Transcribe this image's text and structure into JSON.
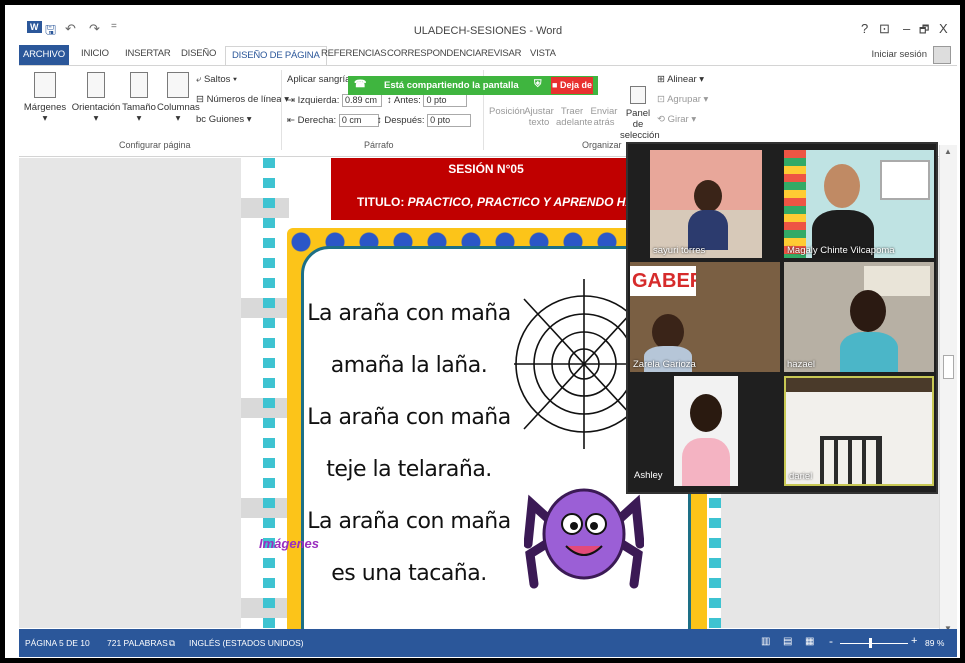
{
  "window": {
    "title": "ULADECH-SESIONES - Word",
    "help": "?",
    "controls": {
      "ribbon_opts": "⊡",
      "minimize": "–",
      "restore": "🗗",
      "close": "X"
    },
    "sign_in": "Iniciar sesión"
  },
  "quick_access": {
    "word_icon": "W",
    "save": "🖫",
    "undo": "↶",
    "redo": "↷",
    "customize": "="
  },
  "tabs": [
    "ARCHIVO",
    "INICIO",
    "INSERTAR",
    "DISEÑO",
    "DISEÑO DE PÁGINA",
    "REFERENCIAS",
    "CORRESPONDENCIA",
    "REVISAR",
    "VISTA"
  ],
  "ribbon": {
    "margenes": "Márgenes",
    "orientacion": "Orientación",
    "tamano": "Tamaño",
    "columnas": "Columnas",
    "saltos": "Saltos",
    "numeros_linea": "Números de línea",
    "guiones": "Guiones",
    "group_configurar": "Configurar página",
    "aplicar_sangria": "Aplicar sangría",
    "izquierda_label": "Izquierda:",
    "izquierda_value": "0.89 cm",
    "derecha_label": "Derecha:",
    "derecha_value": "0 cm",
    "antes_label": "Antes:",
    "antes_value": "0 pto",
    "despues_label": "Después:",
    "despues_value": "0 pto",
    "group_parrafo": "Párrafo",
    "posicion": "Posición",
    "ajustar_texto": "Ajustar texto",
    "traer_adelante": "Traer adelante",
    "enviar_atras": "Enviar atrás",
    "panel_seleccion": "Panel de selección",
    "alinear": "Alinear",
    "agrupar": "Agrupar",
    "girar": "Girar",
    "group_organizar": "Organizar"
  },
  "share_banner": {
    "text": "Está compartiendo la pantalla",
    "stop": "■ Deja de"
  },
  "document": {
    "session": "SESIÓN N°05",
    "title_prefix": "TITULO:",
    "title_text": "PRACTICO, PRACTICO Y APRENDO HABLA",
    "poem": [
      "La araña con maña",
      "amaña la laña.",
      "La araña con maña",
      "teje  la telaraña.",
      "La araña con maña",
      "es una tacaña."
    ],
    "footer_word": "Imágenes"
  },
  "participants": [
    {
      "name": "sayuri torres"
    },
    {
      "name": "Magaly Chinte Vilcapoma"
    },
    {
      "name": "Zarela Garioza",
      "sign_text": "GABER"
    },
    {
      "name": "hazael"
    },
    {
      "name": "Ashley"
    },
    {
      "name": "dariel"
    }
  ],
  "status": {
    "page": "PÁGINA 5 DE 10",
    "words": "721 PALABRAS",
    "language": "INGLÉS (ESTADOS UNIDOS)",
    "zoom": "89 %",
    "zoom_minus": "-",
    "zoom_plus": "+"
  },
  "colors": {
    "accent": "#2b579a",
    "share_green": "#3fb53f",
    "stop_red": "#e8312f",
    "header_red": "#c00000"
  }
}
